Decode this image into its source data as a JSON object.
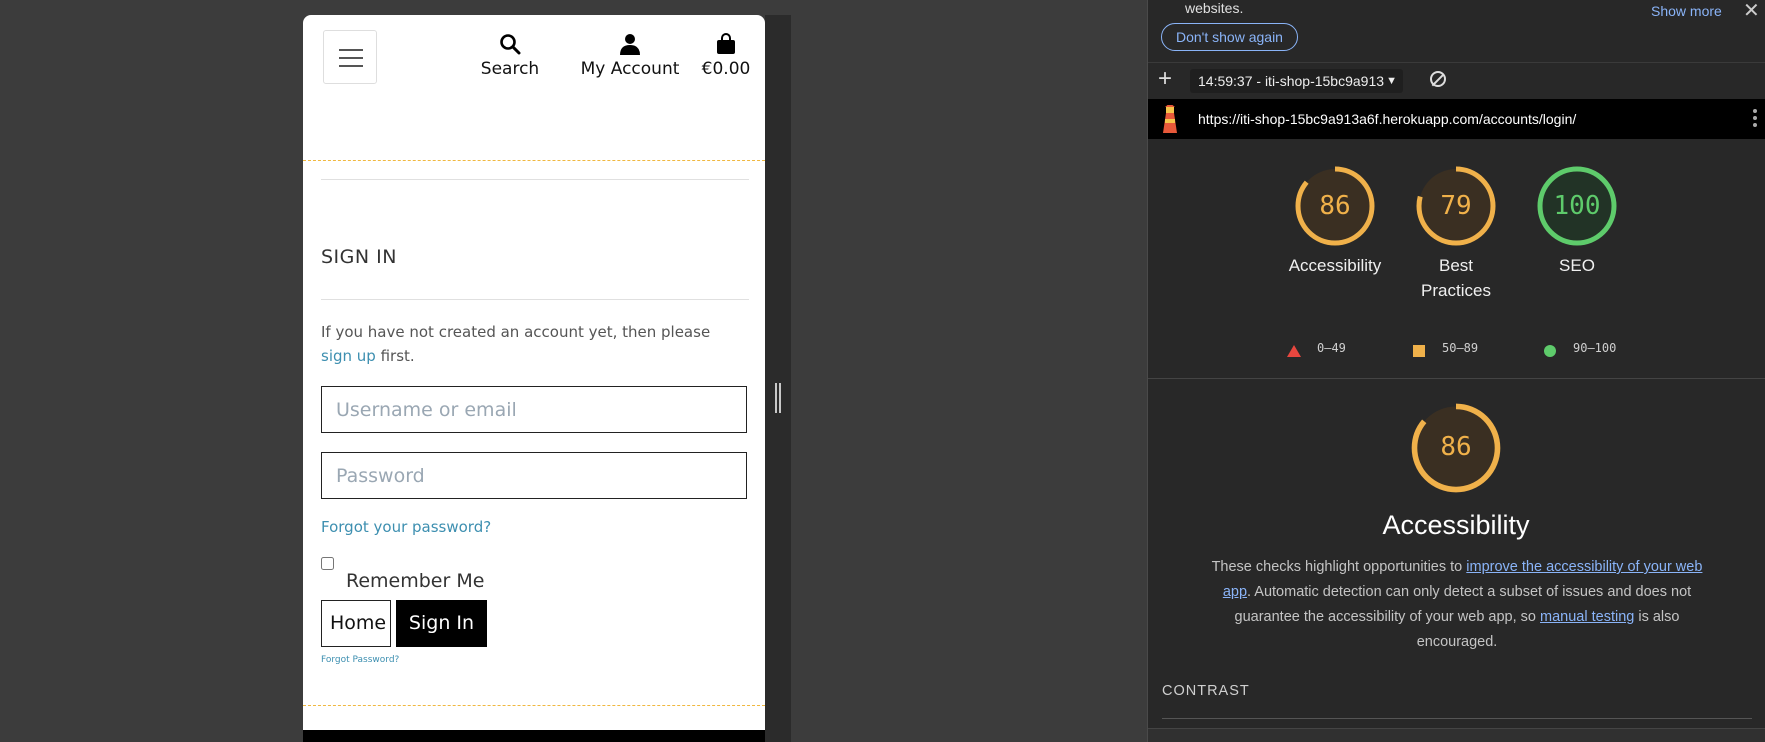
{
  "page": {
    "nav": {
      "search_label": "Search",
      "account_label": "My Account",
      "cart_total": "€0.00"
    },
    "signin_title": "SIGN IN",
    "signup_prefix": "If you have not created an account yet, then please ",
    "signup_link": "sign up",
    "signup_suffix": " first.",
    "username_placeholder": "Username or email",
    "password_placeholder": "Password",
    "forgot_link": "Forgot your password?",
    "remember_label": "Remember Me",
    "home_button": "Home",
    "signin_button": "Sign In",
    "forgot_small": "Forgot Password?"
  },
  "devtools": {
    "notice_text": "websites.",
    "show_more": "Show more",
    "dont_show": "Don't show again",
    "report_select": "14:59:37 - iti-shop-15bc9a913",
    "url": "https://iti-shop-15bc9a913a6f.herokuapp.com/accounts/login/",
    "scores": [
      {
        "value": "86",
        "label": "Accessibility",
        "color": "#f0b14a"
      },
      {
        "value": "79",
        "label": "Best Practices",
        "color": "#f0b14a"
      },
      {
        "value": "100",
        "label": "SEO",
        "color": "#5ecb6b"
      }
    ],
    "legend": [
      {
        "range": "0–49",
        "color": "#e8473f"
      },
      {
        "range": "50–89",
        "color": "#f0b14a"
      },
      {
        "range": "90–100",
        "color": "#5ecb6b"
      }
    ],
    "detail_score": "86",
    "detail_title": "Accessibility",
    "desc_part1": "These checks highlight opportunities to ",
    "desc_link1": "improve the accessibility of your web app",
    "desc_part2": ". Automatic detection can only detect a subset of issues and does not guarantee the accessibility of your web app, so ",
    "desc_link2": "manual testing",
    "desc_part3": " is also encouraged.",
    "section_heading": "CONTRAST"
  }
}
